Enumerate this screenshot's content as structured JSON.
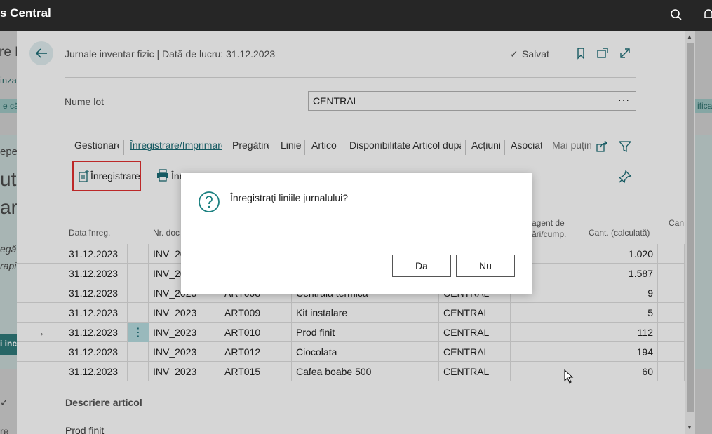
{
  "app": {
    "title_fragment": "s Central"
  },
  "background": {
    "frag_title": "re E",
    "frag_tab": "inza",
    "frag_chip_left": "e că",
    "frag_chip_right": "ifica",
    "frag_big1": "epe",
    "frag_big2": "ut,",
    "frag_big3": "ar",
    "frag_italic1": "egă",
    "frag_italic2": "rapi",
    "frag_btn": "i inc",
    "frag_bottom": "re"
  },
  "header": {
    "title": "Jurnale inventar fizic | Dată de lucru: 31.12.2023",
    "saved_label": "Salvat"
  },
  "lot": {
    "label": "Nume lot",
    "value": "CENTRAL"
  },
  "tabs": [
    {
      "label": "Gestionare"
    },
    {
      "label": "Înregistrare/Imprimare"
    },
    {
      "label": "Pregătire"
    },
    {
      "label": "Linie"
    },
    {
      "label": "Articol"
    },
    {
      "label": "Disponibilitate Articol după"
    },
    {
      "label": "Acțiuni"
    },
    {
      "label": "Asociat"
    },
    {
      "label": "Mai puține"
    }
  ],
  "actions": {
    "post_label": "Înregistrare",
    "print_label": "Înr"
  },
  "grid": {
    "headers": {
      "date": "Data înreg.",
      "doc": "Nr. doc",
      "agent1": "agent de",
      "agent2": "ări/cump.",
      "qty_calc": "Cant. (calculată)",
      "qty_frag": "Can"
    },
    "rows": [
      {
        "date": "31.12.2023",
        "doc": "INV_20",
        "item": "",
        "desc": "",
        "loc": "",
        "qty": "1.020"
      },
      {
        "date": "31.12.2023",
        "doc": "INV_20",
        "item": "",
        "desc": "",
        "loc": "",
        "qty": "1.587"
      },
      {
        "date": "31.12.2023",
        "doc": "INV_2023",
        "item": "ART008",
        "desc": "Centrala termica",
        "loc": "CENTRAL",
        "qty": "9"
      },
      {
        "date": "31.12.2023",
        "doc": "INV_2023",
        "item": "ART009",
        "desc": "Kit instalare",
        "loc": "CENTRAL",
        "qty": "5"
      },
      {
        "date": "31.12.2023",
        "doc": "INV_2023",
        "item": "ART010",
        "desc": "Prod finit",
        "loc": "CENTRAL",
        "qty": "112"
      },
      {
        "date": "31.12.2023",
        "doc": "INV_2023",
        "item": "ART012",
        "desc": "Ciocolata",
        "loc": "CENTRAL",
        "qty": "194"
      },
      {
        "date": "31.12.2023",
        "doc": "INV_2023",
        "item": "ART015",
        "desc": "Cafea boabe 500",
        "loc": "CENTRAL",
        "qty": "60"
      }
    ]
  },
  "details": {
    "title": "Descriere articol",
    "value": "Prod finit"
  },
  "dialog": {
    "message": "Înregistraţi liniile jurnalului?",
    "yes_label": "Da",
    "no_label": "Nu"
  }
}
